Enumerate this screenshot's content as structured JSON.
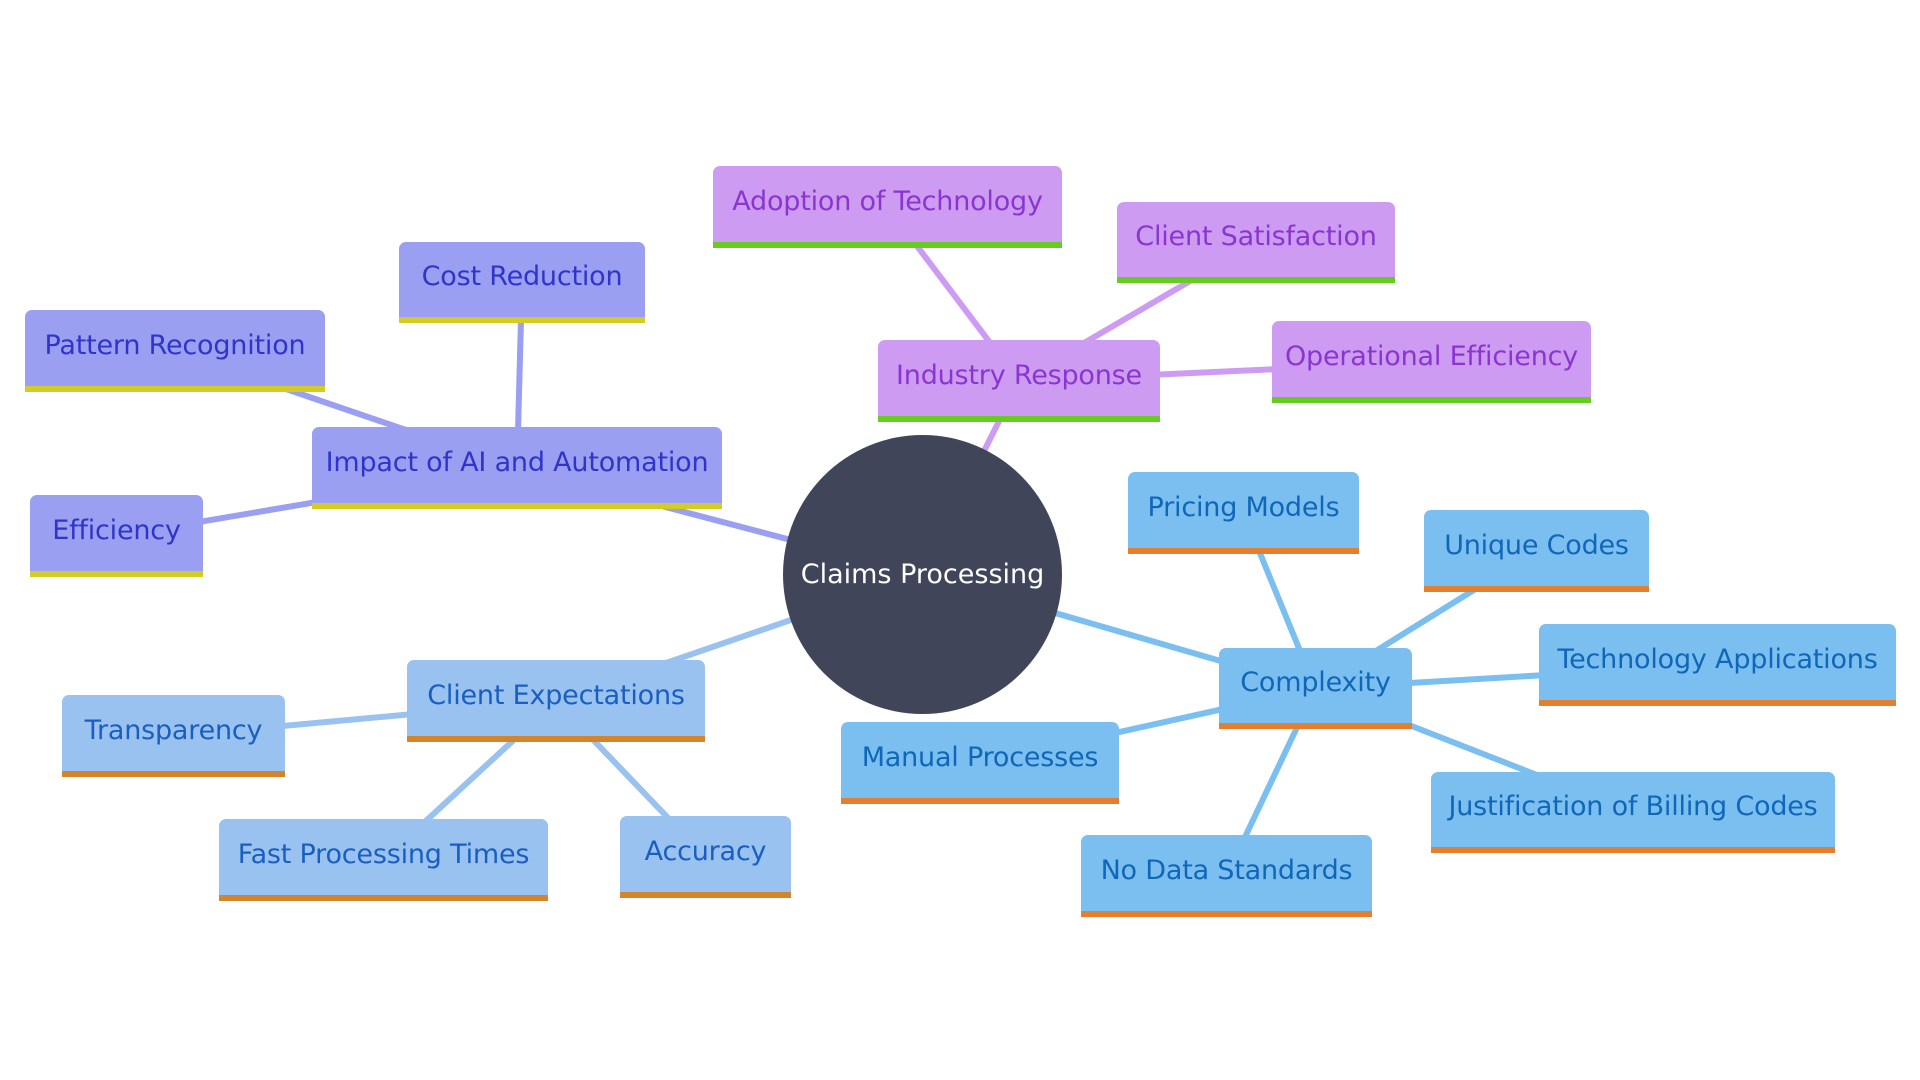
{
  "diagram": {
    "type": "mindmap",
    "root": {
      "id": "root",
      "label": "Claims Processing",
      "color": "#41455a"
    },
    "branches": [
      {
        "id": "ai",
        "label": "Impact of AI and Automation",
        "colors": {
          "fill": "#9a9ff2",
          "text": "#2e35c8",
          "underline": "#d4cc24",
          "edge": "#9a9ff2"
        },
        "children": [
          {
            "id": "ai-cost",
            "label": "Cost Reduction"
          },
          {
            "id": "ai-pattern",
            "label": "Pattern Recognition"
          },
          {
            "id": "ai-eff",
            "label": "Efficiency"
          }
        ]
      },
      {
        "id": "ind",
        "label": "Industry Response",
        "colors": {
          "fill": "#cd9cf2",
          "text": "#8a35d0",
          "underline": "#66cc22",
          "edge": "#cd9cf2"
        },
        "children": [
          {
            "id": "ind-adopt",
            "label": "Adoption of Technology"
          },
          {
            "id": "ind-sat",
            "label": "Client Satisfaction"
          },
          {
            "id": "ind-ops",
            "label": "Operational Efficiency"
          }
        ]
      },
      {
        "id": "cli",
        "label": "Client Expectations",
        "colors": {
          "fill": "#9ac2f0",
          "text": "#1a5fc0",
          "underline": "#d4842a",
          "edge": "#9ac2f0"
        },
        "children": [
          {
            "id": "cli-trans",
            "label": "Transparency"
          },
          {
            "id": "cli-fast",
            "label": "Fast Processing Times"
          },
          {
            "id": "cli-acc",
            "label": "Accuracy"
          }
        ]
      },
      {
        "id": "cpx",
        "label": "Complexity",
        "colors": {
          "fill": "#7bbff0",
          "text": "#1066b8",
          "underline": "#e57f30",
          "edge": "#7bbff0"
        },
        "children": [
          {
            "id": "cpx-pricing",
            "label": "Pricing Models"
          },
          {
            "id": "cpx-codes",
            "label": "Unique Codes"
          },
          {
            "id": "cpx-tech",
            "label": "Technology Applications"
          },
          {
            "id": "cpx-just",
            "label": "Justification of Billing Codes"
          },
          {
            "id": "cpx-manual",
            "label": "Manual Processes"
          },
          {
            "id": "cpx-nodata",
            "label": "No Data Standards"
          }
        ]
      }
    ]
  }
}
